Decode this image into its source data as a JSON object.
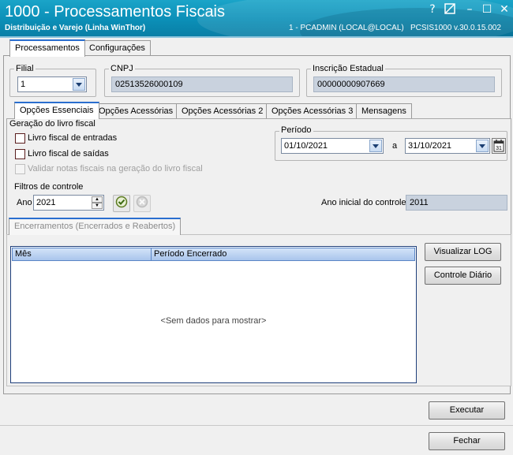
{
  "window": {
    "title": "1000 - Processamentos Fiscais",
    "subtitle": "Distribuição e Varejo (Linha WinThor)",
    "user_info": "1 - PCADMIN (LOCAL@LOCAL)",
    "version_info": "PCSIS1000  v.30.0.15.002",
    "controls": {
      "help": "?",
      "minimize": "–",
      "maximize": "☐",
      "close": "✕"
    }
  },
  "top_tabs": [
    {
      "label": "Processamentos",
      "active": true
    },
    {
      "label": "Configurações",
      "active": false
    }
  ],
  "filial": {
    "label": "Filial",
    "value": "1"
  },
  "cnpj": {
    "label": "CNPJ",
    "value": "02513526000109"
  },
  "inscricao": {
    "label": "Inscrição Estadual",
    "value": "00000000907669"
  },
  "sub_tabs": [
    {
      "label": "Opções Essenciais",
      "active": true
    },
    {
      "label": "Opções Acessórias",
      "active": false
    },
    {
      "label": "Opções Acessórias 2",
      "active": false
    },
    {
      "label": "Opções Acessórias 3",
      "active": false
    },
    {
      "label": "Mensagens",
      "active": false
    }
  ],
  "geracao": {
    "label": "Geração do livro fiscal",
    "entradas": "Livro fiscal de entradas",
    "saidas": "Livro fiscal de saídas",
    "validar": "Validar notas fiscais na geração do livro fiscal"
  },
  "periodo": {
    "label": "Período",
    "start": "01/10/2021",
    "separator": "a",
    "end": "31/10/2021"
  },
  "filtros": {
    "label": "Filtros de controle",
    "ano_label": "Ano",
    "ano_value": "2021",
    "ano_inicial_label": "Ano inicial do controle",
    "ano_inicial_value": "2011"
  },
  "encerramentos": {
    "tab_label": "Encerramentos (Encerrados e Reabertos)",
    "columns": [
      "Mês",
      "Período Encerrado"
    ],
    "empty_text": "<Sem dados para mostrar>"
  },
  "buttons": {
    "visualizar_log": "Visualizar LOG",
    "controle_diario": "Controle Diário",
    "executar": "Executar",
    "fechar": "Fechar"
  },
  "icons": {
    "confirm": "check-circle-icon",
    "cancel": "x-circle-icon",
    "calendar": "calendar-icon"
  }
}
